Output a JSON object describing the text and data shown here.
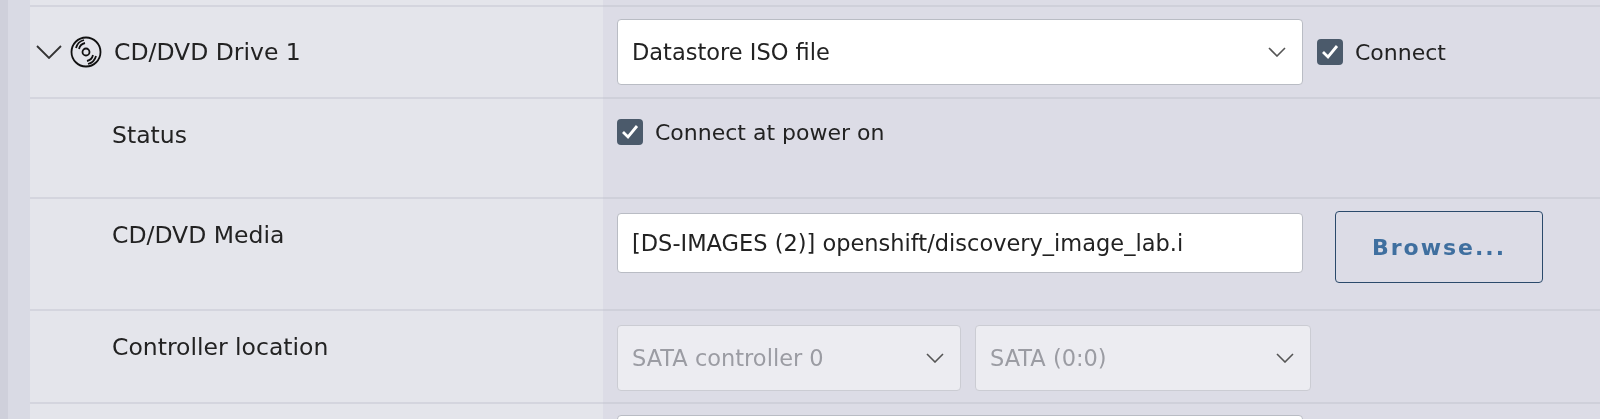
{
  "device": {
    "name": "CD/DVD Drive 1",
    "expanded": true,
    "type": {
      "value": "Datastore ISO file"
    },
    "connect": {
      "label": "Connect",
      "checked": true
    }
  },
  "rows": [
    {
      "kind": "checkbox",
      "label": "Status",
      "option": {
        "label": "Connect at power on",
        "checked": true
      }
    },
    {
      "kind": "file",
      "label": "CD/DVD Media",
      "value": "[DS-IMAGES (2)] openshift/discovery_image_lab.i",
      "button": "Browse..."
    },
    {
      "kind": "selects",
      "label": "Controller location",
      "selects": [
        {
          "value": "SATA controller 0",
          "disabled": true
        },
        {
          "value": "SATA (0:0)",
          "disabled": true
        }
      ]
    },
    {
      "kind": "partial"
    }
  ]
}
